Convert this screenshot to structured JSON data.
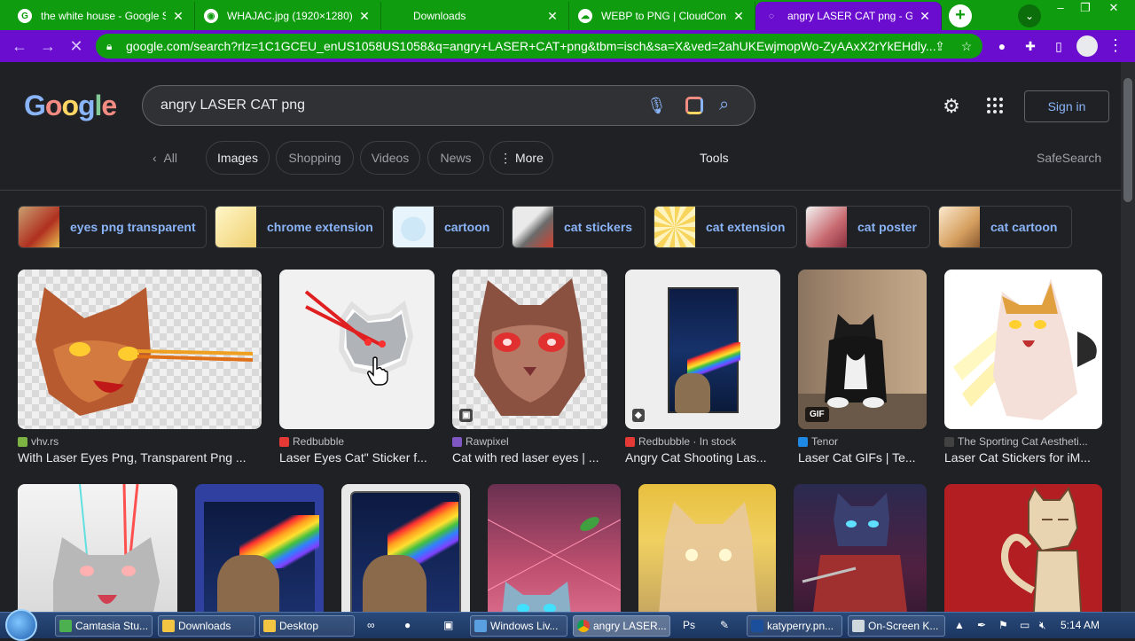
{
  "browser": {
    "tabs": [
      {
        "title": "the white house - Google S",
        "favicon": "google-icon",
        "active": false
      },
      {
        "title": "WHAJAC.jpg (1920×1280)",
        "favicon": "image-icon",
        "active": false
      },
      {
        "title": "Downloads",
        "favicon": "download-icon",
        "active": false
      },
      {
        "title": "WEBP to PNG | CloudConve",
        "favicon": "cloudconvert-icon",
        "active": false
      },
      {
        "title": "angry LASER CAT png - Goo",
        "favicon": "loading-icon",
        "active": true
      }
    ],
    "url": "google.com/search?rlz=1C1GCEU_enUS1058US1058&q=angry+LASER+CAT+png&tbm=isch&sa=X&ved=2ahUKEwjmopWo-ZyAAxX2rYkEHdly...",
    "tab_strip_color": "#0f9d0f",
    "toolbar_color": "#6a0dcf"
  },
  "google": {
    "logo": [
      "G",
      "o",
      "o",
      "g",
      "l",
      "e"
    ],
    "query": "angry LASER CAT png",
    "sign_in": "Sign in",
    "filters": {
      "all": "All",
      "images": "Images",
      "shopping": "Shopping",
      "videos": "Videos",
      "news": "News",
      "more": "More",
      "tools": "Tools",
      "safesearch": "SafeSearch"
    },
    "related": [
      "eyes png transparent",
      "chrome extension",
      "cartoon",
      "cat stickers",
      "cat extension",
      "cat poster",
      "cat cartoon"
    ],
    "results": [
      {
        "source": "vhv.rs",
        "title": "With Laser Eyes Png, Transparent Png ...",
        "badge": ""
      },
      {
        "source": "Redbubble",
        "title": "Laser Eyes Cat\" Sticker f...",
        "badge": ""
      },
      {
        "source": "Rawpixel",
        "title": "Cat with red laser eyes | ...",
        "badge": ""
      },
      {
        "source": "Redbubble · In stock",
        "title": "Angry Cat Shooting Las...",
        "badge": ""
      },
      {
        "source": "Tenor",
        "title": "Laser Cat GIFs | Te...",
        "badge": "GIF"
      },
      {
        "source": "The Sporting Cat Aestheti...",
        "title": "Laser Cat Stickers for iM...",
        "badge": ""
      }
    ]
  },
  "taskbar": {
    "items": [
      "Camtasia Stu...",
      "Downloads",
      "Desktop",
      "Windows Liv...",
      "angry LASER...",
      "katyperry.pn...",
      "On-Screen K..."
    ],
    "clock": "5:14 AM"
  }
}
